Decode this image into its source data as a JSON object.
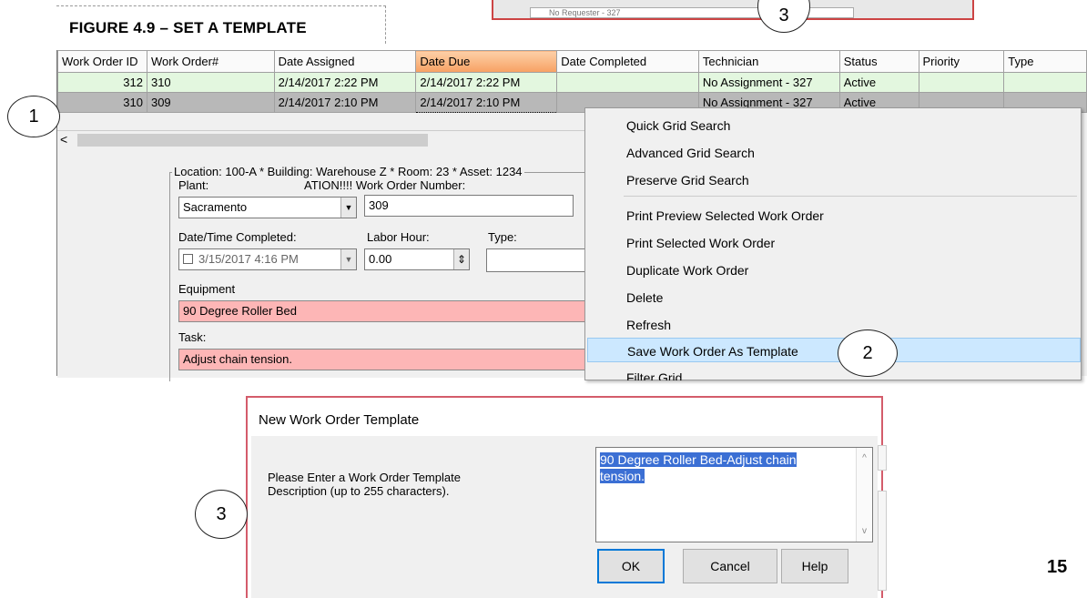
{
  "figure_title": "FIGURE 4.9 – SET A TEMPLATE",
  "page_number": "15",
  "top_window_peek": "No Requester - 327",
  "callouts": [
    "1",
    "2",
    "3",
    "3"
  ],
  "grid": {
    "headers": [
      "Work Order ID",
      "Work Order#",
      "Date Assigned",
      "Date Due",
      "Date Completed",
      "Technician",
      "Status",
      "Priority",
      "Type"
    ],
    "rows": [
      [
        "312",
        "310",
        "2/14/2017 2:22 PM",
        "2/14/2017 2:22 PM",
        "",
        "No Assignment - 327",
        "Active",
        "",
        ""
      ],
      [
        "310",
        "309",
        "2/14/2017 2:10 PM",
        "2/14/2017 2:10 PM",
        "",
        "No Assignment - 327",
        "Active",
        "",
        ""
      ]
    ],
    "scroll_left": "<"
  },
  "form": {
    "location_line": "Location: 100-A * Building: Warehouse Z * Room: 23 * Asset: 1234",
    "plant_label": "Plant:",
    "wo_number_label": "ATION!!!! Work Order Number:",
    "plant_value": "Sacramento",
    "wo_number_value": "309",
    "datetime_label": "Date/Time Completed:",
    "labor_label": "Labor Hour:",
    "type_label": "Type:",
    "datetime_value": "3/15/2017  4:16 PM",
    "labor_value": "0.00",
    "type_value": "",
    "equipment_label": "Equipment",
    "equipment_value": "90 Degree Roller Bed",
    "task_label": "Task:",
    "task_value": "Adjust chain tension."
  },
  "context_menu": {
    "items": [
      "Quick Grid Search",
      "Advanced Grid Search",
      "Preserve Grid Search",
      "Print Preview Selected Work Order",
      "Print Selected Work Order",
      "Duplicate Work Order",
      "Delete",
      "Refresh",
      "Save Work Order As Template",
      "Filter Grid..."
    ],
    "highlighted": "Save Work Order As Template"
  },
  "dialog": {
    "title": "New Work Order Template",
    "prompt_line1": "Please Enter a Work Order Template",
    "prompt_line2": "Description (up to 255 characters).",
    "description_line1": "90 Degree Roller Bed-Adjust chain",
    "description_line2": "tension.",
    "ok_label": "OK",
    "cancel_label": "Cancel",
    "help_label": "Help"
  },
  "colors": {
    "grid_row_active": "#e3f7df",
    "grid_row_selected": "#b8b8b8",
    "date_due_header": "#f7a163",
    "required_field": "#fdb6b6",
    "menu_highlight": "#cce8ff",
    "dialog_border": "#d45c6b",
    "text_selection": "#3b6fd4"
  }
}
